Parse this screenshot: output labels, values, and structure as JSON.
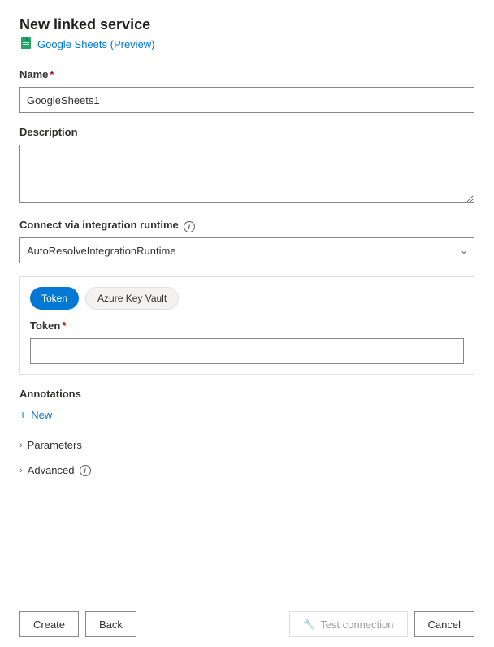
{
  "header": {
    "title": "New linked service",
    "subtitle": "Google Sheets (Preview)"
  },
  "form": {
    "name_label": "Name",
    "name_required": "*",
    "name_value": "GoogleSheets1",
    "description_label": "Description",
    "description_placeholder": "",
    "integration_runtime_label": "Connect via integration runtime",
    "integration_runtime_value": "AutoResolveIntegrationRuntime",
    "integration_runtime_options": [
      "AutoResolveIntegrationRuntime"
    ],
    "token_tab_label": "Token",
    "azure_key_vault_tab_label": "Azure Key Vault",
    "token_field_label": "Token",
    "token_required": "*",
    "token_placeholder": ""
  },
  "annotations": {
    "label": "Annotations",
    "new_button": "New"
  },
  "parameters": {
    "label": "Parameters"
  },
  "advanced": {
    "label": "Advanced"
  },
  "footer": {
    "create_label": "Create",
    "back_label": "Back",
    "test_connection_label": "Test connection",
    "cancel_label": "Cancel"
  },
  "icons": {
    "info": "i",
    "chevron_down": "⌄",
    "chevron_right": "›",
    "plus": "+",
    "wrench": "🔧"
  }
}
